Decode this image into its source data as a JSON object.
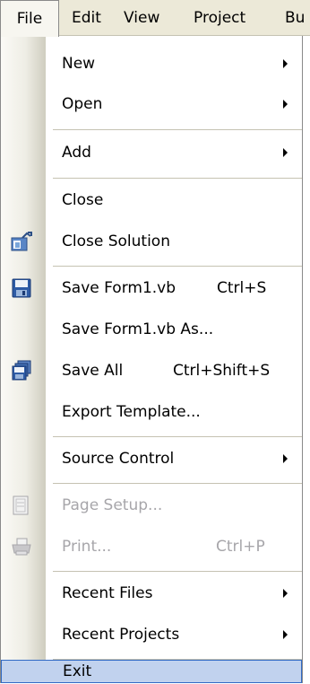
{
  "menubar": {
    "file": "File",
    "edit": "Edit",
    "view": "View",
    "project": "Project",
    "build": "Bu"
  },
  "menu": {
    "items": [
      {
        "label": "New",
        "submenu": true
      },
      {
        "label": "Open",
        "submenu": true
      },
      {
        "label": "Add",
        "submenu": true
      },
      {
        "label": "Close"
      },
      {
        "label": "Close Solution",
        "icon": "close-solution-icon"
      },
      {
        "label": "Save Form1.vb",
        "shortcut": "Ctrl+S",
        "icon": "save-icon"
      },
      {
        "label": "Save Form1.vb As..."
      },
      {
        "label": "Save All",
        "shortcut": "Ctrl+Shift+S",
        "icon": "save-all-icon"
      },
      {
        "label": "Export Template..."
      },
      {
        "label": "Source Control",
        "submenu": true
      },
      {
        "label": "Page Setup...",
        "disabled": true,
        "icon": "page-setup-icon"
      },
      {
        "label": "Print...",
        "shortcut": "Ctrl+P",
        "disabled": true,
        "icon": "print-icon"
      },
      {
        "label": "Recent Files",
        "submenu": true
      },
      {
        "label": "Recent Projects",
        "submenu": true
      },
      {
        "label": "Exit",
        "highlighted": true
      }
    ]
  },
  "colors": {
    "menubar_bg": "#ece9d8",
    "highlight_bg": "#c1d2ee",
    "highlight_border": "#316ac5",
    "disabled_text": "#a7a6aa"
  }
}
